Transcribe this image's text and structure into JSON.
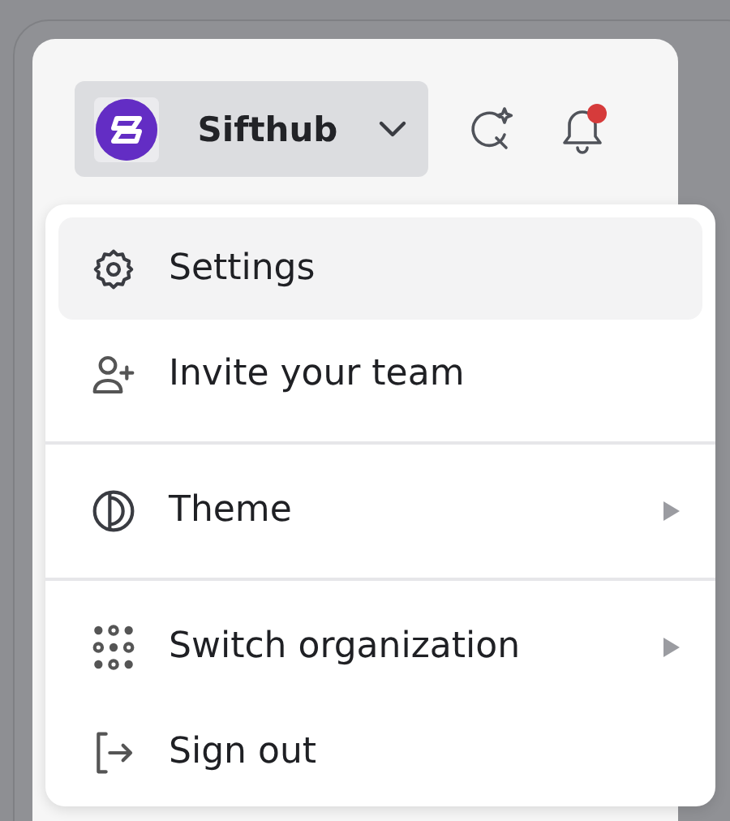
{
  "workspace": {
    "name": "Sifthub",
    "has_notification": true
  },
  "menu": {
    "groups": [
      {
        "items": [
          {
            "label": "Settings",
            "selected": true,
            "submenu": false
          },
          {
            "label": "Invite your team",
            "selected": false,
            "submenu": false
          }
        ]
      },
      {
        "items": [
          {
            "label": "Theme",
            "selected": false,
            "submenu": true
          }
        ]
      },
      {
        "items": [
          {
            "label": "Switch organization",
            "selected": false,
            "submenu": true
          },
          {
            "label": "Sign out",
            "selected": false,
            "submenu": false
          }
        ]
      }
    ]
  }
}
